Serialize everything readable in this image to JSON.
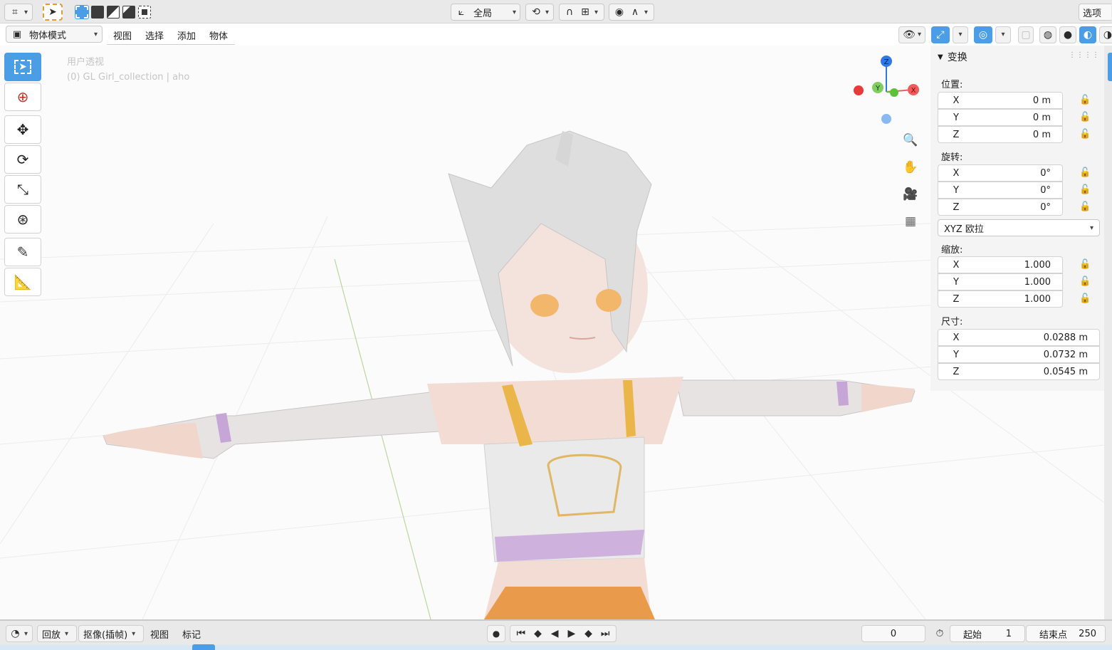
{
  "topbar": {
    "transform_orientation": "全局",
    "options_label": "选项"
  },
  "header": {
    "mode": "物体模式",
    "menus": [
      "视图",
      "选择",
      "添加",
      "物体"
    ]
  },
  "viewport": {
    "view_name": "用户透视",
    "collection_info": "(0) GL Girl_collection | aho",
    "gizmo": {
      "z": "Z",
      "y": "Y",
      "x": "X"
    }
  },
  "npanel": {
    "title": "变换",
    "location_label": "位置:",
    "location": [
      {
        "axis": "X",
        "value": "0 m"
      },
      {
        "axis": "Y",
        "value": "0 m"
      },
      {
        "axis": "Z",
        "value": "0 m"
      }
    ],
    "rotation_label": "旋转:",
    "rotation": [
      {
        "axis": "X",
        "value": "0°"
      },
      {
        "axis": "Y",
        "value": "0°"
      },
      {
        "axis": "Z",
        "value": "0°"
      }
    ],
    "rotation_mode": "XYZ 欧拉",
    "scale_label": "缩放:",
    "scale": [
      {
        "axis": "X",
        "value": "1.000"
      },
      {
        "axis": "Y",
        "value": "1.000"
      },
      {
        "axis": "Z",
        "value": "1.000"
      }
    ],
    "dimensions_label": "尺寸:",
    "dimensions": [
      {
        "axis": "X",
        "value": "0.0288 m"
      },
      {
        "axis": "Y",
        "value": "0.0732 m"
      },
      {
        "axis": "Z",
        "value": "0.0545 m"
      }
    ]
  },
  "timeline": {
    "playback": "回放",
    "keying": "抠像(插帧)",
    "view": "视图",
    "marker": "标记",
    "current_frame": "0",
    "start_label": "起始",
    "start_value": "1",
    "end_label": "结束点",
    "end_value": "250"
  },
  "colors": {
    "accent": "#4b9de5",
    "axis_x": "#f25a5a",
    "axis_y": "#5fc13a",
    "axis_z": "#2d7ae6"
  }
}
